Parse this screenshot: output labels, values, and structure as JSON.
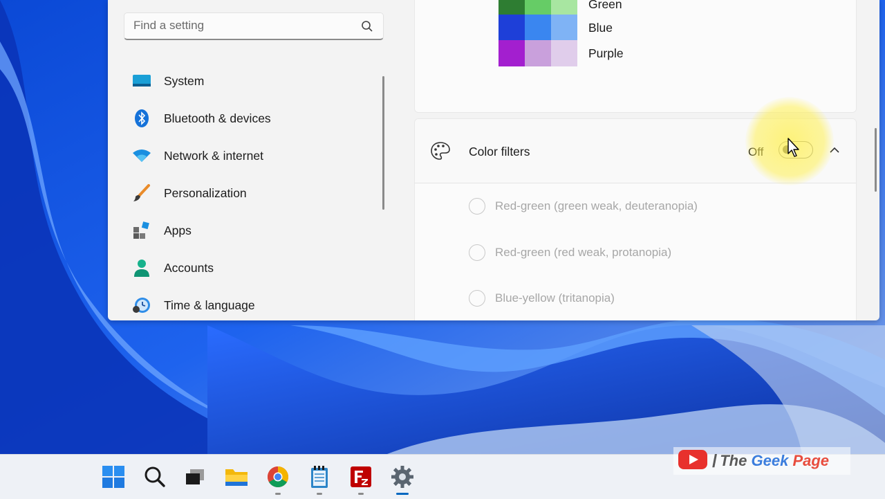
{
  "search": {
    "placeholder": "Find a setting",
    "icon": "search-icon"
  },
  "sidebar": {
    "items": [
      {
        "label": "System",
        "icon": "system-icon"
      },
      {
        "label": "Bluetooth & devices",
        "icon": "bluetooth-icon"
      },
      {
        "label": "Network & internet",
        "icon": "wifi-icon"
      },
      {
        "label": "Personalization",
        "icon": "brush-icon"
      },
      {
        "label": "Apps",
        "icon": "apps-icon"
      },
      {
        "label": "Accounts",
        "icon": "person-icon"
      },
      {
        "label": "Time & language",
        "icon": "clock-globe-icon"
      }
    ]
  },
  "color_grid": {
    "rows": [
      {
        "label": "Green",
        "colors": [
          "#2e7d32",
          "#66cc66",
          "#a8e6a1"
        ]
      },
      {
        "label": "Blue",
        "colors": [
          "#1e3fd8",
          "#3a86f0",
          "#7fb3f5"
        ]
      },
      {
        "label": "Purple",
        "colors": [
          "#a31fcf",
          "#c9a0dc",
          "#e0cdeb"
        ]
      }
    ]
  },
  "color_filters": {
    "title": "Color filters",
    "state_label": "Off",
    "toggle_on": false,
    "expanded": true,
    "options": [
      "Red-green (green weak, deuteranopia)",
      "Red-green (red weak, protanopia)",
      "Blue-yellow (tritanopia)"
    ]
  },
  "taskbar": {
    "icons": [
      {
        "name": "start-icon",
        "running": false
      },
      {
        "name": "search-icon",
        "running": false
      },
      {
        "name": "task-view-icon",
        "running": false
      },
      {
        "name": "file-explorer-icon",
        "running": false
      },
      {
        "name": "chrome-icon",
        "running": true
      },
      {
        "name": "notepad-icon",
        "running": true
      },
      {
        "name": "filezilla-icon",
        "running": true
      },
      {
        "name": "settings-icon",
        "running": true,
        "active": true
      }
    ]
  },
  "watermark": {
    "the": "The",
    "geek": "Geek",
    "page": "Page"
  },
  "accent_color": "#0067c0"
}
